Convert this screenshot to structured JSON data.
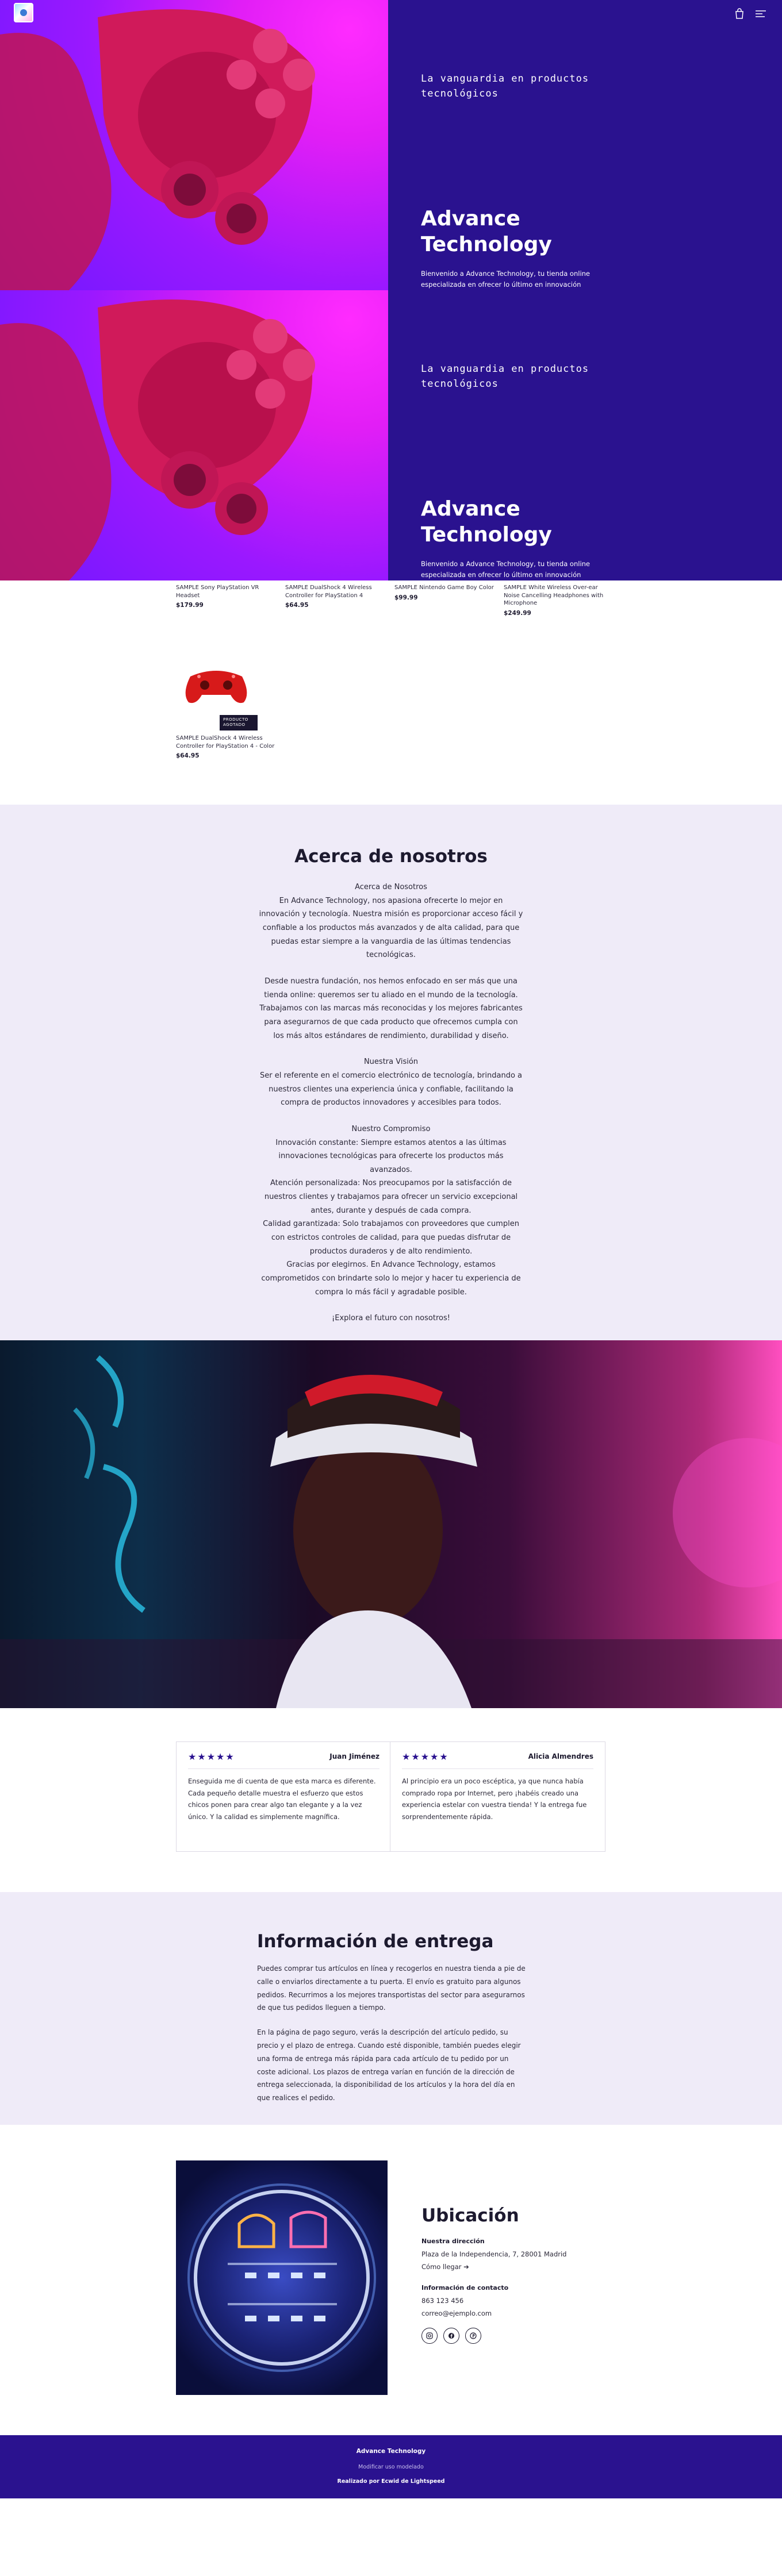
{
  "header": {
    "logo_icon": "gamepad-logo-icon",
    "cart_icon": "bag-icon",
    "menu_icon": "menu-icon"
  },
  "hero": [
    {
      "tagline": "La vanguardia en productos tecnológicos",
      "title": "Advance Technology",
      "description": "Bienvenido a Advance Technology, tu tienda online especializada en ofrecer lo último en innovación tecnológica. Desde dispositivos de última generación hasta accesorios esenciales para mejorar tu experiencia digital, en nuestra tienda encontrarás todo lo que necesitas para estar a la vanguardia del futuro."
    },
    {
      "tagline": "La vanguardia en productos tecnológicos",
      "title": "Advance Technology",
      "description": "Bienvenido a Advance Technology, tu tienda online especializada en ofrecer lo último en innovación tecnológica. Desde dispositivos de última generación hasta accesorios esenciales para mejorar tu experiencia digital, en nuestra tienda encontrarás todo lo que necesitas para estar a la vanguardia del futuro."
    }
  ],
  "products": [
    {
      "name": "SAMPLE Sony PlayStation VR Headset",
      "price": "$179.99"
    },
    {
      "name": "SAMPLE DualShock 4 Wireless Controller for PlayStation 4",
      "price": "$64.95"
    },
    {
      "name": "SAMPLE Nintendo Game Boy Color",
      "price": "$99.99"
    },
    {
      "name": "SAMPLE White Wireless Over-ear Noise Cancelling Headphones with Microphone",
      "price": "$249.99"
    },
    {
      "name": "SAMPLE DualShock 4 Wireless Controller for PlayStation 4 - Color",
      "price": "$64.95",
      "badge": "PRODUCTO AGOTADO"
    }
  ],
  "about": {
    "title": "Acerca de nosotros",
    "paragraphs": [
      "Acerca de Nosotros\nEn Advance Technology, nos apasiona ofrecerte lo mejor en innovación y tecnología. Nuestra misión es proporcionar acceso fácil y confiable a los productos más avanzados y de alta calidad, para que puedas estar siempre a la vanguardia de las últimas tendencias tecnológicas.",
      "Desde nuestra fundación, nos hemos enfocado en ser más que una tienda online: queremos ser tu aliado en el mundo de la tecnología. Trabajamos con las marcas más reconocidas y los mejores fabricantes para asegurarnos de que cada producto que ofrecemos cumpla con los más altos estándares de rendimiento, durabilidad y diseño.",
      "Nuestra Visión\nSer el referente en el comercio electrónico de tecnología, brindando a nuestros clientes una experiencia única y confiable, facilitando la compra de productos innovadores y accesibles para todos.",
      "Nuestro Compromiso\nInnovación constante: Siempre estamos atentos a las últimas innovaciones tecnológicas para ofrecerte los productos más avanzados.\nAtención personalizada: Nos preocupamos por la satisfacción de nuestros clientes y trabajamos para ofrecer un servicio excepcional antes, durante y después de cada compra.\nCalidad garantizada: Solo trabajamos con proveedores que cumplen con estrictos controles de calidad, para que puedas disfrutar de productos duraderos y de alto rendimiento.\nGracias por elegirnos. En Advance Technology, estamos comprometidos con brindarte solo lo mejor y hacer tu experiencia de compra lo más fácil y agradable posible.",
      "¡Explora el futuro con nosotros!"
    ]
  },
  "testimonials": [
    {
      "stars": "★★★★★",
      "name": "Juan Jiménez",
      "text": "Enseguida me di cuenta de que esta marca es diferente. Cada pequeño detalle muestra el esfuerzo que estos chicos ponen para crear algo tan elegante y a la vez único. Y la calidad es simplemente magnífica."
    },
    {
      "stars": "★★★★★",
      "name": "Alicia Almendres",
      "text": "Al principio era un poco escéptica, ya que nunca había comprado ropa por Internet, pero ¡habéis creado una experiencia estelar con vuestra tienda! Y la entrega fue sorprendentemente rápida."
    }
  ],
  "delivery": {
    "title": "Información de entrega",
    "paragraphs": [
      "Puedes comprar tus artículos en línea y recogerlos en nuestra tienda a pie de calle o enviarlos directamente a tu puerta. El envío es gratuito para algunos pedidos. Recurrimos a los mejores transportistas del sector para asegurarnos de que tus pedidos lleguen a tiempo.",
      "En la página de pago seguro, verás la descripción del artículo pedido, su precio y el plazo de entrega. Cuando esté disponible, también puedes elegir una forma de entrega más rápida para cada artículo de tu pedido por un coste adicional. Los plazos de entrega varían en función de la dirección de entrega seleccionada, la disponibilidad de los artículos y la hora del día en que realices el pedido."
    ]
  },
  "location": {
    "title": "Ubicación",
    "address_label": "Nuestra dirección",
    "address_line1": "Plaza de la Independencia, 7, 28001 Madrid",
    "address_line2": "Cómo llegar ➔",
    "contact_label": "Información de contacto",
    "phone": "863 123 456",
    "email": "correo@ejemplo.com",
    "social_icons": [
      "instagram-icon",
      "facebook-icon",
      "pinterest-icon"
    ]
  },
  "footer": {
    "title": "Advance Technology",
    "link": "Modificar uso modelado",
    "made_with": "Realizado por  Ecwid de Lightspeed"
  },
  "colors": {
    "primary": "#2a128f",
    "lavender": "#efebf8",
    "magenta": "#e21ef6"
  }
}
